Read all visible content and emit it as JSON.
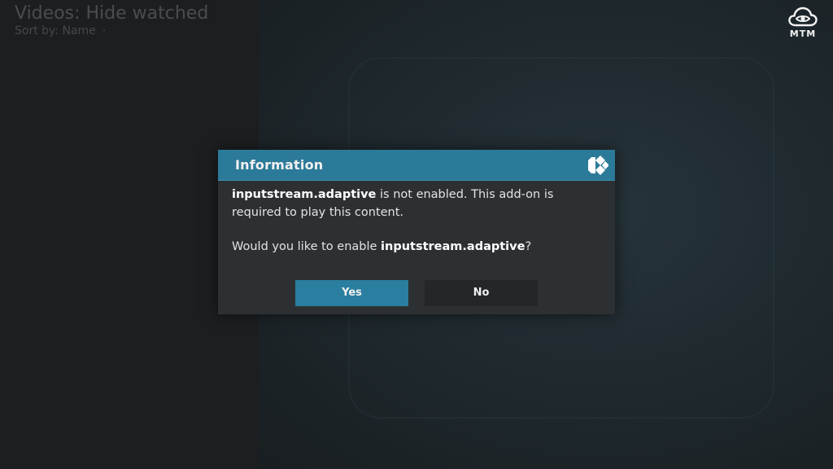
{
  "header": {
    "title": "Videos: Hide watched",
    "sort_label": "Sort by: Name",
    "sort_separator": "·"
  },
  "logo": {
    "icon": "cloud-eye-icon",
    "text": "MTM"
  },
  "dialog": {
    "title": "Information",
    "icon": "kodi-logo-icon",
    "message_line1_bold": "inputstream.adaptive",
    "message_line1_rest": " is not enabled. This add-on is required to play this content.",
    "message_line2_prefix": "Would you like to enable ",
    "message_line2_bold": "inputstream.adaptive",
    "message_line2_suffix": "?",
    "yes_label": "Yes",
    "no_label": "No"
  },
  "colors": {
    "header_bar": "#2c7a99",
    "yes_button": "#2a7ea0",
    "no_button": "#24272a",
    "dialog_bg": "#2d3033"
  }
}
